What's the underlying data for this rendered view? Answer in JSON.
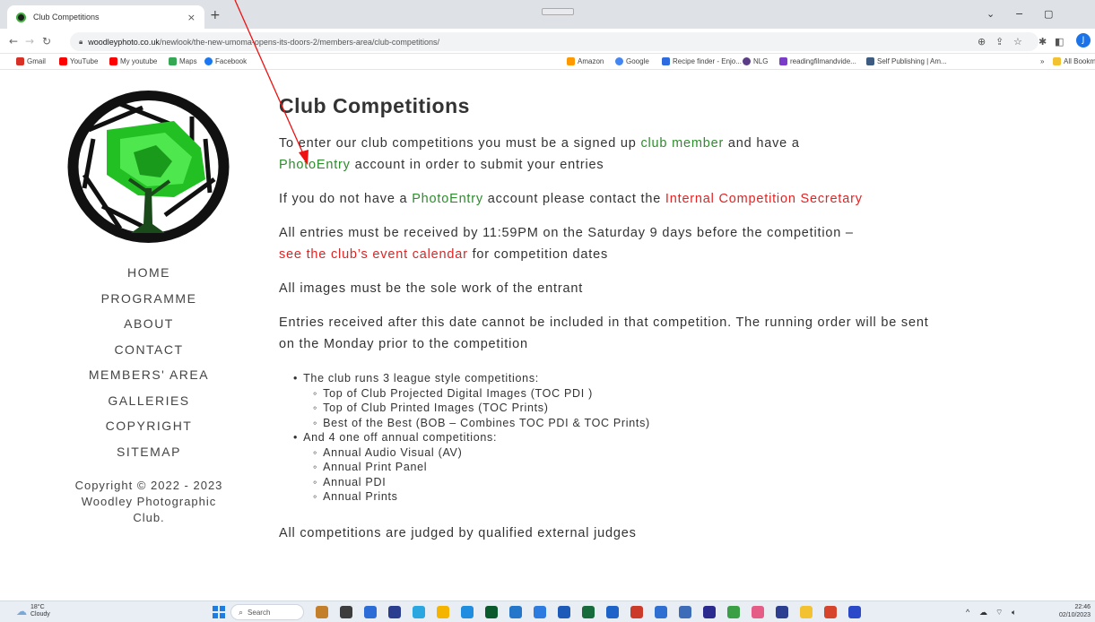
{
  "browser": {
    "tab_title": "Club Competitions",
    "tab_close": "×",
    "new_tab": "+",
    "url_host": "woodleyphoto.co.uk",
    "url_path": "/newlook/the-new-umoma-opens-its-doors-2/members-area/club-competitions/",
    "profile_initial": "J",
    "window_controls": [
      "⌄",
      "−",
      "▢"
    ]
  },
  "bookmarks": {
    "left": [
      {
        "label": "Gmail",
        "color": "#d93025"
      },
      {
        "label": "YouTube",
        "color": "#ff0000"
      },
      {
        "label": "My youtube",
        "color": "#ff0000"
      },
      {
        "label": "Maps",
        "color": "#34a853"
      },
      {
        "label": "Facebook",
        "color": "#1877f2"
      }
    ],
    "right": [
      {
        "label": "Amazon",
        "color": "#ff9900"
      },
      {
        "label": "Google",
        "color": "#4285f4"
      },
      {
        "label": "Recipe finder - Enjo...",
        "color": "#2d6ce0"
      },
      {
        "label": "NLG",
        "color": "#5b3c88"
      },
      {
        "label": "readingfilmandvide...",
        "color": "#7a3cc9"
      },
      {
        "label": "Self Publishing | Am...",
        "color": "#3d5a80"
      }
    ],
    "overflow": "»",
    "all_bookmarks": "All Bookma"
  },
  "site": {
    "logo_icon": "aperture-tree-logo",
    "nav": [
      "HOME",
      "PROGRAMME",
      "ABOUT",
      "CONTACT",
      "MEMBERS' AREA",
      "GALLERIES",
      "COPYRIGHT",
      "SITEMAP"
    ],
    "copyright_line1": "Copyright © 2022 - 2023",
    "copyright_line2": "Woodley Photographic",
    "copyright_line3": "Club."
  },
  "content": {
    "title": "Club Competitions",
    "p1_a": "To enter our club competitions you must be a signed up ",
    "p1_link1": "club member",
    "p1_b": " and have a ",
    "p1_link2": "PhotoEntry",
    "p1_c": " account in order to submit your entries",
    "p2_a": "If you do not have a ",
    "p2_link1": "PhotoEntry",
    "p2_b": " account please contact the ",
    "p2_link2": "Internal Competition Secretary",
    "p3_a": "All entries must be received by 11:59PM on the Saturday 9 days before the competition –",
    "p3_link": "see the club’s event calendar",
    "p3_b": " for competition dates",
    "p4": "All images must be the sole work of the entrant",
    "p5": "Entries received after this date cannot be included in that competition. The running order will be sent on the Monday prior to the competition",
    "list1_title": "The club runs 3 league style competitions:",
    "list1_items": [
      "Top of Club Projected Digital Images (TOC PDI )",
      "Top of Club Printed Images (TOC Prints)",
      "Best of the Best (BOB – Combines TOC PDI & TOC Prints)"
    ],
    "list2_title": "And 4 one off annual competitions:",
    "list2_items": [
      "Annual Audio Visual (AV)",
      "Annual Print Panel",
      "Annual PDI",
      "Annual Prints"
    ],
    "footer": "All competitions are judged by qualified external judges"
  },
  "taskbar": {
    "temp": "18°C",
    "weather": "Cloudy",
    "search_label": "Search",
    "time": "22:46",
    "date": "02/10/2023",
    "app_colors": [
      "#c47f2a",
      "#3d3d3d",
      "#2b6cd6",
      "#2b3d8f",
      "#2aa7e0",
      "#f4b400",
      "#1f8de0",
      "#0b5a2b",
      "#2376c9",
      "#2b7be0",
      "#1e5bb8",
      "#186b3a",
      "#1e64c8",
      "#cc3b2a",
      "#2f6fd1",
      "#3d6cb9",
      "#2a2a8f",
      "#3b9f46",
      "#e55d87",
      "#2c3e8f",
      "#f2c230",
      "#d6452b",
      "#2a49c9"
    ]
  }
}
